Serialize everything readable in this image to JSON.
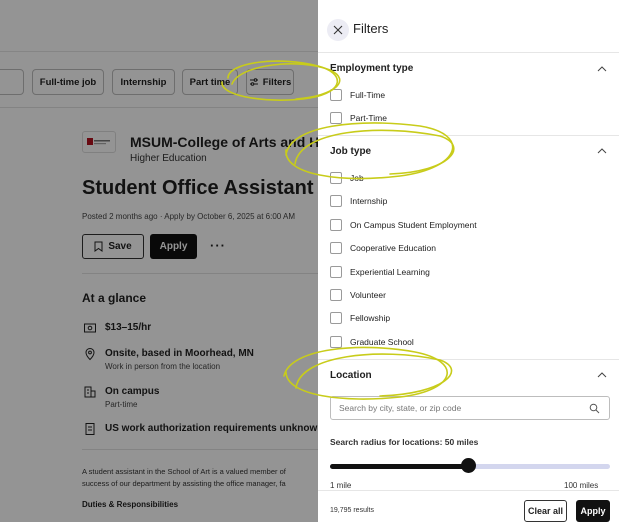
{
  "background": {
    "chips": [
      {
        "label": "Full-time job"
      },
      {
        "label": "Internship"
      },
      {
        "label": "Part time"
      },
      {
        "label": "Filters"
      }
    ],
    "employer_name": "MSUM-College of Arts and Hum",
    "employer_industry": "Higher Education",
    "job_title": "Student Office Assistant",
    "posted": "Posted 2 months ago · Apply by October 6, 2025 at 6:00 AM",
    "save_label": "Save",
    "apply_label": "Apply",
    "more_label": "···",
    "glance_title": "At a glance",
    "glance": {
      "pay": "$13–15/hr",
      "location_main": "Onsite, based in Moorhead, MN",
      "location_sub": "Work in person from the location",
      "campus_main": "On campus",
      "campus_sub": "Part-time",
      "auth_main": "US work authorization requirements unknow"
    },
    "description_line1": "A student assistant in the School of Art is a valued member of",
    "description_line2": "success of our department by assisting the office manager, fa",
    "duties_title": "Duties & Responsibilities"
  },
  "filters": {
    "title": "Filters",
    "employment_type": {
      "heading": "Employment type",
      "options": [
        "Full-Time",
        "Part-Time"
      ]
    },
    "job_type": {
      "heading": "Job type",
      "options": [
        "Job",
        "Internship",
        "On Campus Student Employment",
        "Cooperative Education",
        "Experiential Learning",
        "Volunteer",
        "Fellowship",
        "Graduate School"
      ]
    },
    "location": {
      "heading": "Location",
      "placeholder": "Search by city, state, or zip code",
      "radius_label": "Search radius for locations: 50 miles",
      "radius_value": 50,
      "radius_min_label": "1 mile",
      "radius_max_label": "100 miles",
      "radius_min": 1,
      "radius_max": 100
    },
    "results": "19,795 results",
    "clear_label": "Clear all",
    "apply_label": "Apply"
  },
  "colors": {
    "primary": "#111111",
    "slider_track": "#d3d6ee",
    "annotation": "#c8cc1a"
  }
}
